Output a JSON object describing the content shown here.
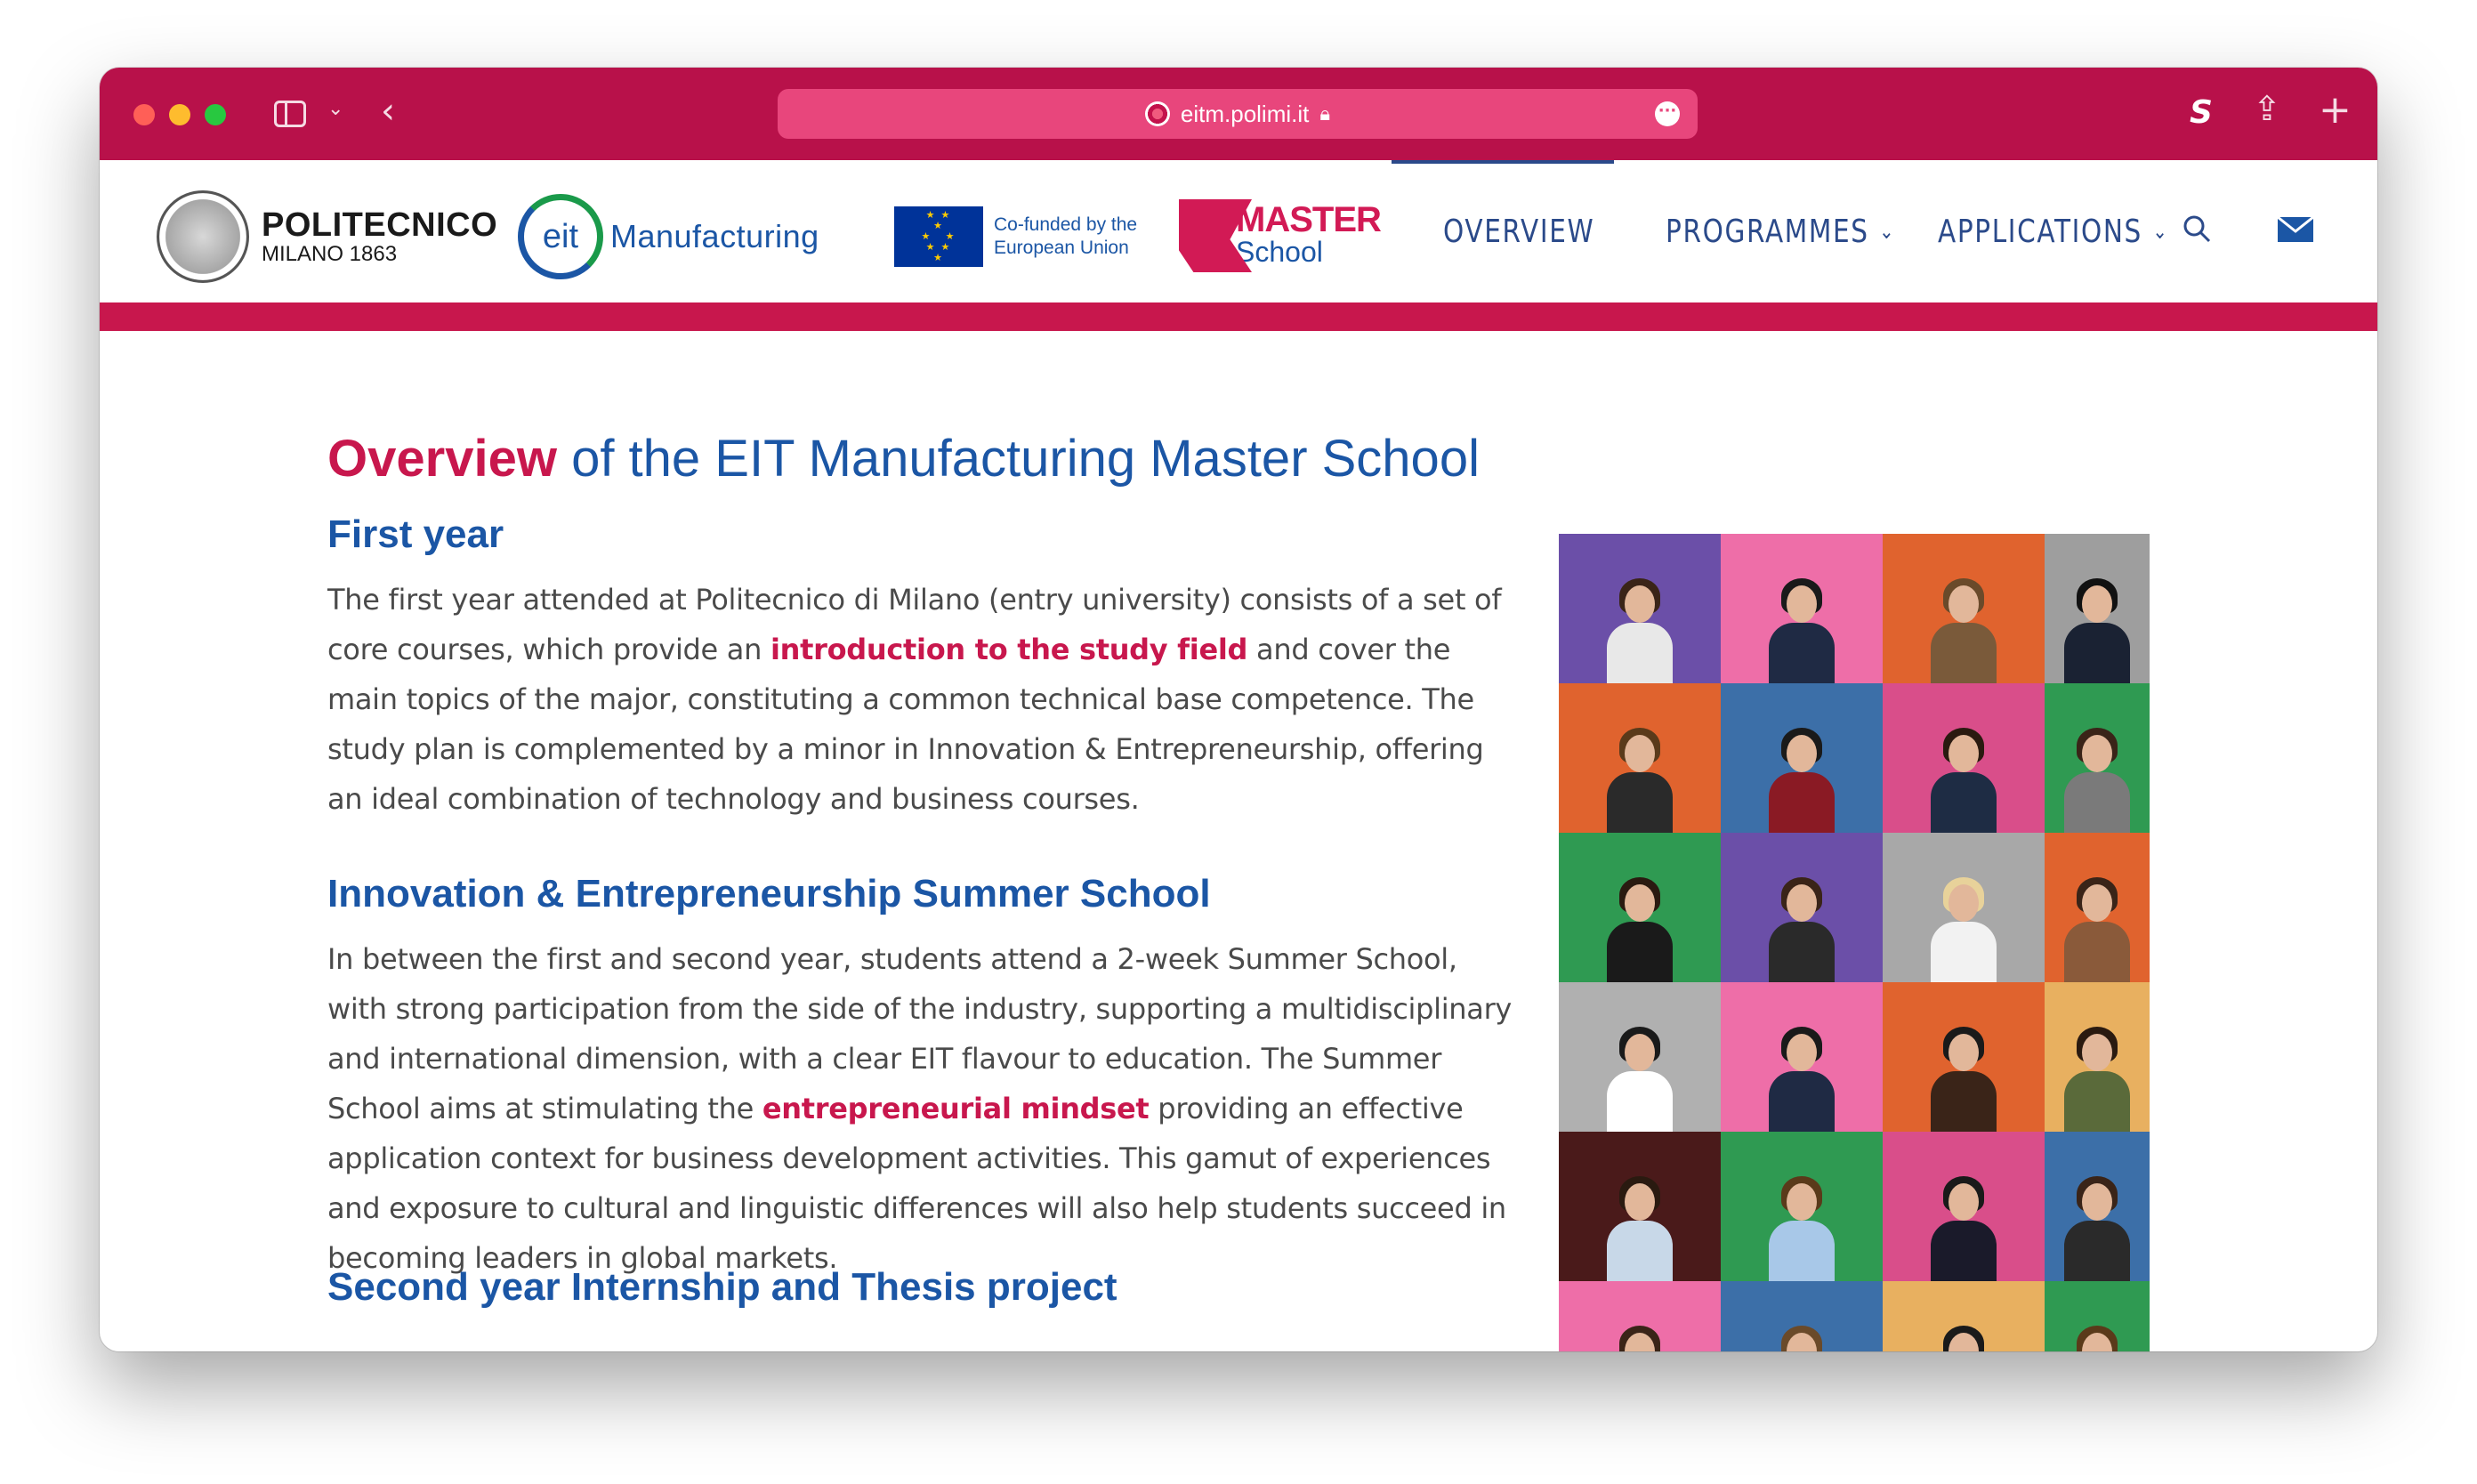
{
  "browser": {
    "url": "eitm.polimi.it",
    "colors": {
      "toolbar": "#b8114a",
      "addressbar": "#e8467c"
    }
  },
  "header": {
    "logos": {
      "politecnico_name": "POLITECNICO",
      "politecnico_sub": "MILANO 1863",
      "eit_mark": "eit",
      "eit_word": "Manufacturing",
      "eu_line1": "Co-funded by the",
      "eu_line2": "European Union",
      "master_top": "MASTER",
      "master_bottom": "School"
    },
    "nav": {
      "overview": "OVERVIEW",
      "programmes": "PROGRAMMES",
      "applications": "APPLICATIONS"
    },
    "icons": [
      "search-icon",
      "mail-icon"
    ],
    "accent_color": "#c8174d",
    "nav_color": "#2b4a8a"
  },
  "content": {
    "title_accent": "Overview",
    "title_rest": " of the EIT Manufacturing Master School",
    "sections": [
      {
        "heading": "First year",
        "p_before": "The first year attended at Politecnico di Milano (entry university) consists of a set of core courses, which provide an ",
        "p_highlight": "introduction to the study field",
        "p_after": " and cover the main topics of the major, constituting a common technical base competence. The study plan is complemented by a minor in Innovation & Entrepreneurship, offering an ideal combination of technology and business courses."
      },
      {
        "heading": "Innovation & Entrepreneurship Summer School",
        "p_before": "In between the first and second year, students attend a 2-week Summer School, with strong participation from the side of the industry, supporting a multidisciplinary and international dimension, with a clear EIT flavour to education. The Summer School aims at stimulating the ",
        "p_highlight": "entrepreneurial mindset",
        "p_after": " providing an effective application context for business development activities. This gamut of experiences and exposure to cultural and linguistic differences will also help students succeed in becoming leaders in global markets."
      },
      {
        "heading": "Second year Internship and Thesis project"
      }
    ],
    "heading_color": "#1b56a5",
    "highlight_color": "#c8174d"
  },
  "photo_grid": {
    "tiles": [
      {
        "bg": "#6b4fa8",
        "shirt": "#e8e8e8",
        "hair": "#3a2418"
      },
      {
        "bg": "#ee6ea8",
        "shirt": "#1f2a44",
        "hair": "#1a1a1a"
      },
      {
        "bg": "#e0632e",
        "shirt": "#7a5a3a",
        "hair": "#6a4a2a"
      },
      {
        "bg": "#9e9e9e",
        "shirt": "#1a2233",
        "hair": "#111111"
      },
      {
        "bg": "#e0632e",
        "shirt": "#2a2a2a",
        "hair": "#5a3a1a"
      },
      {
        "bg": "#3c6fa8",
        "shirt": "#8a1a24",
        "hair": "#1a1a1a"
      },
      {
        "bg": "#d94e8a",
        "shirt": "#1e2c44",
        "hair": "#2a1a10"
      },
      {
        "bg": "#2f9a52",
        "shirt": "#7a7a7a",
        "hair": "#3a2418"
      },
      {
        "bg": "#2f9a52",
        "shirt": "#1a1a1a",
        "hair": "#2a1a10"
      },
      {
        "bg": "#6b4fa8",
        "shirt": "#2a2a2a",
        "hair": "#3a2418"
      },
      {
        "bg": "#a8a8a8",
        "shirt": "#f2f2f2",
        "hair": "#e8d29a"
      },
      {
        "bg": "#e0632e",
        "shirt": "#8a5a3a",
        "hair": "#3a2418"
      },
      {
        "bg": "#b0b0b0",
        "shirt": "#ffffff",
        "hair": "#1a1a1a"
      },
      {
        "bg": "#ee6ea8",
        "shirt": "#1f2a44",
        "hair": "#1a1a1a"
      },
      {
        "bg": "#e0632e",
        "shirt": "#3a2418",
        "hair": "#1a1a1a"
      },
      {
        "bg": "#e8b060",
        "shirt": "#5a6a3a",
        "hair": "#2a1a10"
      },
      {
        "bg": "#4a1a1a",
        "shirt": "#c8d8e8",
        "hair": "#2a1a10"
      },
      {
        "bg": "#2f9a52",
        "shirt": "#a8c8e8",
        "hair": "#5a3a1a"
      },
      {
        "bg": "#d94e8a",
        "shirt": "#1a1a2a",
        "hair": "#1a1a1a"
      },
      {
        "bg": "#3c6fa8",
        "shirt": "#2a2a2a",
        "hair": "#3a2418"
      },
      {
        "bg": "#ee6ea8",
        "shirt": "#3a2418",
        "hair": "#3a2418"
      },
      {
        "bg": "#3c6fa8",
        "shirt": "#6a6a6a",
        "hair": "#6a4a2a"
      },
      {
        "bg": "#e8b060",
        "shirt": "#2a2a2a",
        "hair": "#1a1a1a"
      },
      {
        "bg": "#2f9a52",
        "shirt": "#e8e8e8",
        "hair": "#5a3a1a"
      }
    ]
  }
}
